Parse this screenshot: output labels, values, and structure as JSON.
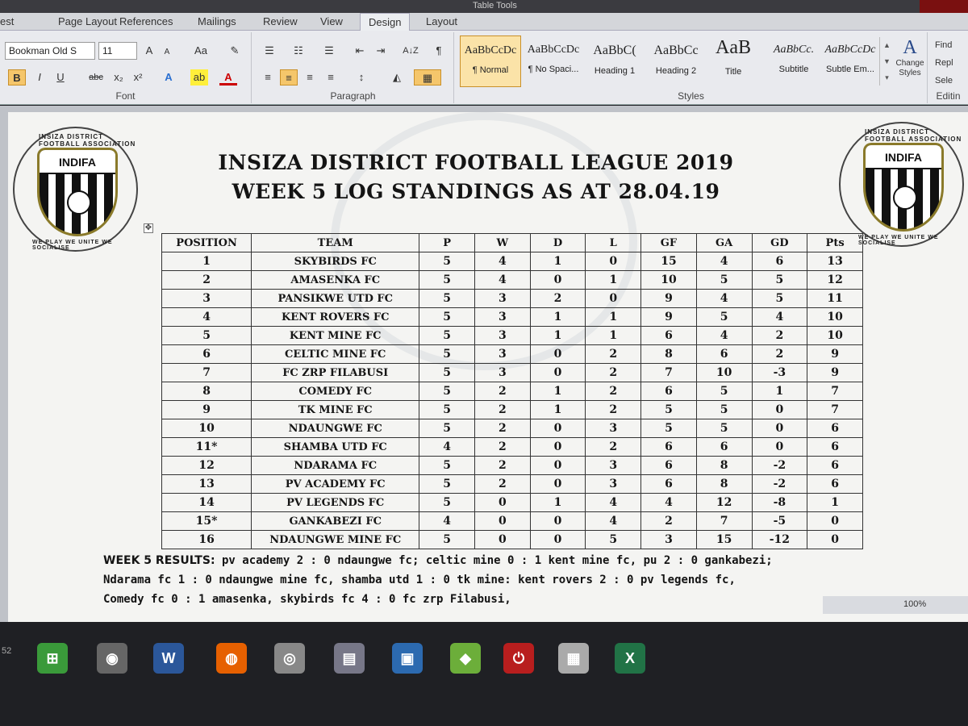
{
  "window": {
    "context_title": "Table Tools"
  },
  "tabs": [
    "est",
    "Page Layout",
    "References",
    "Mailings",
    "Review",
    "View",
    "Design",
    "Layout"
  ],
  "ribbon": {
    "font": {
      "name": "Bookman Old S",
      "size": "11",
      "group_label": "Font",
      "buttons": {
        "grow": "A",
        "shrink": "A",
        "case": "Aa",
        "clear": "✎",
        "bold": "B",
        "italic": "I",
        "underline": "U",
        "strike": "abc",
        "sub": "x₂",
        "sup": "x²",
        "effects": "A",
        "highlight": "ab",
        "color": "A"
      }
    },
    "paragraph": {
      "group_label": "Paragraph",
      "pilcrow": "¶",
      "sort": "A↓Z"
    },
    "styles": {
      "group_label": "Styles",
      "items": [
        {
          "sample": "AaBbCcDc",
          "name": "¶ Normal"
        },
        {
          "sample": "AaBbCcDc",
          "name": "¶ No Spaci..."
        },
        {
          "sample": "AaBbC(",
          "name": "Heading 1"
        },
        {
          "sample": "AaBbCc",
          "name": "Heading 2"
        },
        {
          "sample": "AaB",
          "name": "Title"
        },
        {
          "sample": "AaBbCc.",
          "name": "Subtitle"
        },
        {
          "sample": "AaBbCcDc",
          "name": "Subtle Em..."
        }
      ],
      "change_styles": "Change Styles"
    },
    "editing": {
      "group_label": "Editin",
      "find": "Find",
      "replace": "Repl",
      "select": "Sele"
    }
  },
  "document": {
    "crest": {
      "name": "INDIFA",
      "ring_top": "INSIZA DISTRICT FOOTBALL ASSOCIATION",
      "ring_bottom": "WE PLAY WE UNITE WE SOCIALISE"
    },
    "title_line1": "INSIZA DISTRICT FOOTBALL LEAGUE 2019",
    "title_line2": "WEEK 5 LOG STANDINGS AS AT 28.04.19",
    "table": {
      "headers": [
        "POSITION",
        "TEAM",
        "P",
        "W",
        "D",
        "L",
        "GF",
        "GA",
        "GD",
        "Pts"
      ],
      "rows": [
        [
          "1",
          "SKYBIRDS FC",
          "5",
          "4",
          "1",
          "0",
          "15",
          "4",
          "6",
          "13"
        ],
        [
          "2",
          "AMASENKA FC",
          "5",
          "4",
          "0",
          "1",
          "10",
          "5",
          "5",
          "12"
        ],
        [
          "3",
          "PANSIKWE UTD FC",
          "5",
          "3",
          "2",
          "0",
          "9",
          "4",
          "5",
          "11"
        ],
        [
          "4",
          "KENT ROVERS FC",
          "5",
          "3",
          "1",
          "1",
          "9",
          "5",
          "4",
          "10"
        ],
        [
          "5",
          "KENT MINE FC",
          "5",
          "3",
          "1",
          "1",
          "6",
          "4",
          "2",
          "10"
        ],
        [
          "6",
          "CELTIC MINE FC",
          "5",
          "3",
          "0",
          "2",
          "8",
          "6",
          "2",
          "9"
        ],
        [
          "7",
          "FC ZRP FILABUSI",
          "5",
          "3",
          "0",
          "2",
          "7",
          "10",
          "-3",
          "9"
        ],
        [
          "8",
          "COMEDY FC",
          "5",
          "2",
          "1",
          "2",
          "6",
          "5",
          "1",
          "7"
        ],
        [
          "9",
          "TK MINE FC",
          "5",
          "2",
          "1",
          "2",
          "5",
          "5",
          "0",
          "7"
        ],
        [
          "10",
          "NDAUNGWE FC",
          "5",
          "2",
          "0",
          "3",
          "5",
          "5",
          "0",
          "6"
        ],
        [
          "11*",
          "SHAMBA UTD FC",
          "4",
          "2",
          "0",
          "2",
          "6",
          "6",
          "0",
          "6"
        ],
        [
          "12",
          "NDARAMA FC",
          "5",
          "2",
          "0",
          "3",
          "6",
          "8",
          "-2",
          "6"
        ],
        [
          "13",
          "PV ACADEMY FC",
          "5",
          "2",
          "0",
          "3",
          "6",
          "8",
          "-2",
          "6"
        ],
        [
          "14",
          "PV LEGENDS FC",
          "5",
          "0",
          "1",
          "4",
          "4",
          "12",
          "-8",
          "1"
        ],
        [
          "15*",
          "GANKABEZI FC",
          "4",
          "0",
          "0",
          "4",
          "2",
          "7",
          "-5",
          "0"
        ],
        [
          "16",
          "NDAUNGWE MINE FC",
          "5",
          "0",
          "0",
          "5",
          "3",
          "15",
          "-12",
          "0"
        ]
      ]
    },
    "results": {
      "label": "WEEK 5 RESULTS:",
      "line1": "pv academy 2 : 0 ndaungwe fc;  celtic mine 0 : 1 kent mine fc, pu 2 : 0 gankabezi;",
      "line2": "shamba utd 1 : 0 tk mine: kent rovers 2 : 0 pv legends fc,",
      "line3": "Comedy fc 0 : 1 amasenka, skybirds fc 4 : 0 fc zrp Filabusi,",
      "line2_prefix": "Ndarama fc 1 : 0 ndaungwe mine fc,"
    },
    "zoom": "100%"
  },
  "taskbar": {
    "corner_number": "52",
    "apps": [
      {
        "icon": "windows-store-icon",
        "glyph": "⊞",
        "color": "#3a9a3a"
      },
      {
        "icon": "speaker-app-icon",
        "glyph": "◉",
        "color": "#666"
      },
      {
        "icon": "word-icon",
        "glyph": "W",
        "color": "#2b579a"
      },
      {
        "icon": "firefox-icon",
        "glyph": "◍",
        "color": "#e66000"
      },
      {
        "icon": "media-app-icon",
        "glyph": "◎",
        "color": "#888"
      },
      {
        "icon": "document-app-icon",
        "glyph": "▤",
        "color": "#778"
      },
      {
        "icon": "settings-app-icon",
        "glyph": "▣",
        "color": "#2c6ab0"
      },
      {
        "icon": "bluestacks-icon",
        "glyph": "◆",
        "color": "#6cae3a"
      },
      {
        "icon": "power-app-icon",
        "glyph": "⏻",
        "color": "#b81e1e"
      },
      {
        "icon": "calculator-icon",
        "glyph": "▦",
        "color": "#aaa"
      },
      {
        "icon": "excel-icon",
        "glyph": "X",
        "color": "#217346"
      }
    ]
  }
}
